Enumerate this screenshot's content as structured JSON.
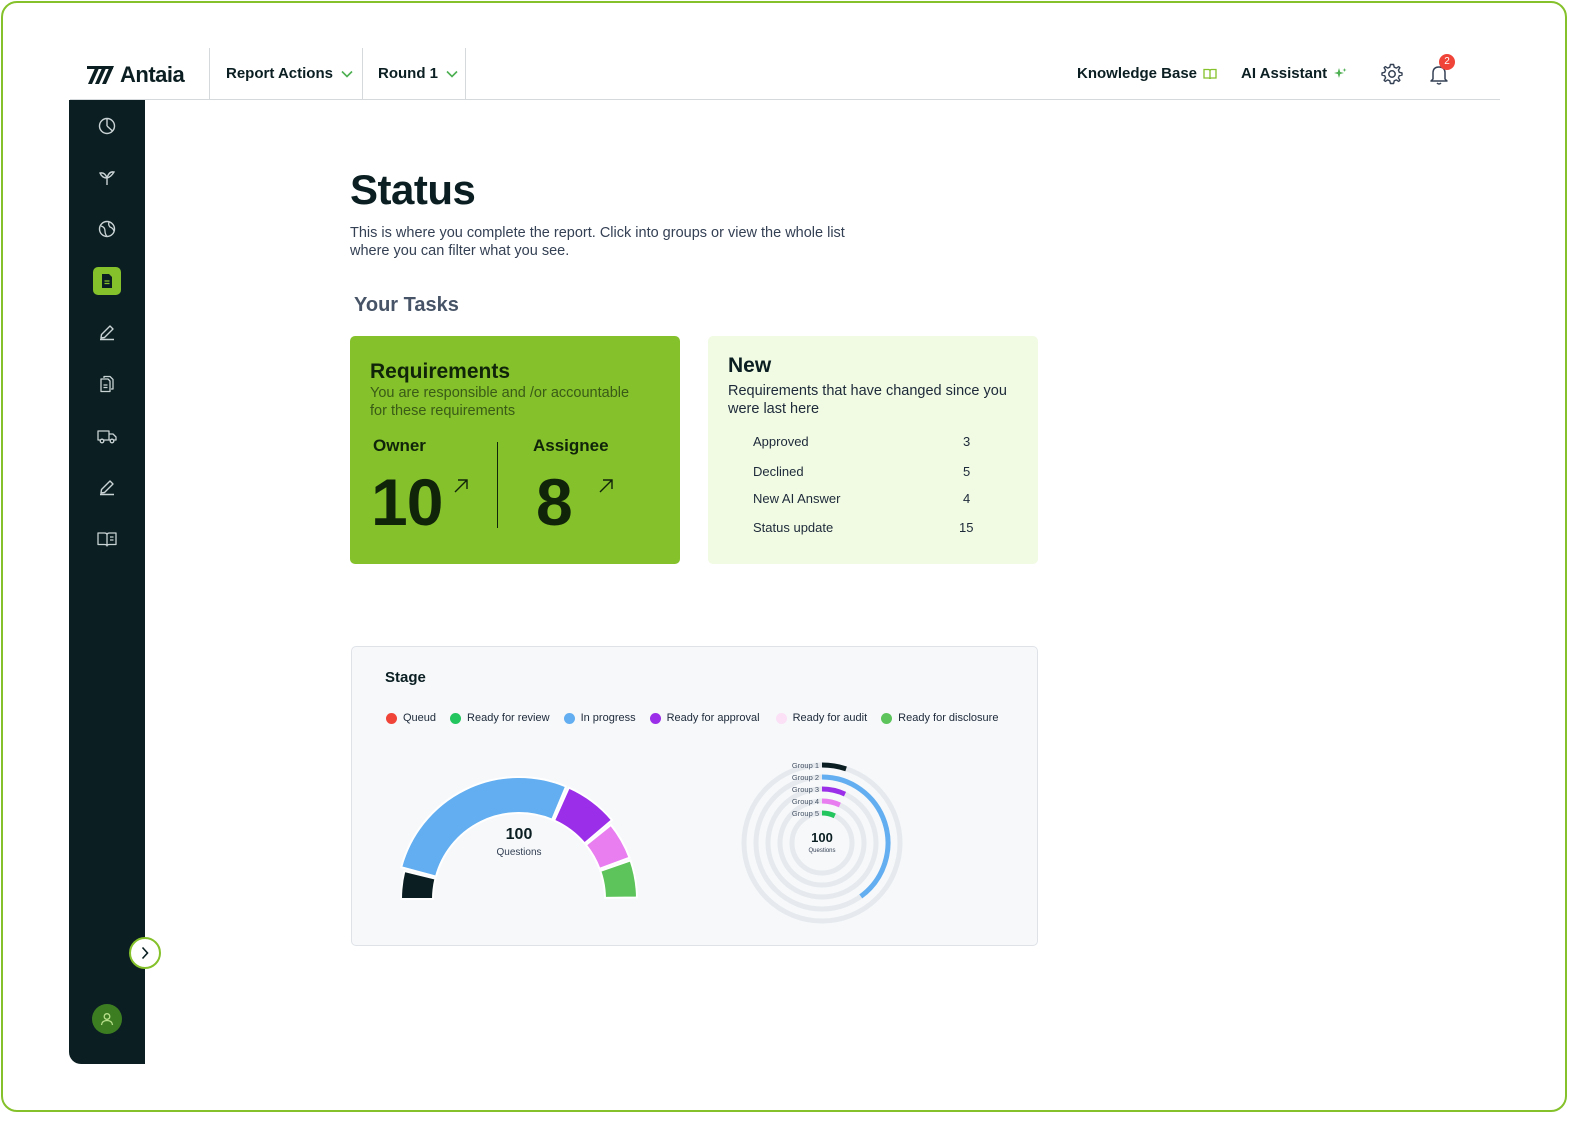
{
  "app": {
    "brand": "Antaia"
  },
  "header": {
    "menus": [
      {
        "label": "Report Actions"
      },
      {
        "label": "Round 1"
      }
    ],
    "knowledge_base": "Knowledge Base",
    "ai_assistant": "AI Assistant",
    "notification_count": "2"
  },
  "sidebar": {
    "items": [
      {
        "icon": "pie-chart-icon",
        "active": false
      },
      {
        "icon": "sprout-icon",
        "active": false
      },
      {
        "icon": "globe-icon",
        "active": false
      },
      {
        "icon": "document-icon",
        "active": true
      },
      {
        "icon": "pencil-icon",
        "active": false
      },
      {
        "icon": "files-icon",
        "active": false
      },
      {
        "icon": "truck-icon",
        "active": false
      },
      {
        "icon": "pencil-icon",
        "active": false
      },
      {
        "icon": "book-icon",
        "active": false
      }
    ]
  },
  "page": {
    "title": "Status",
    "subtitle": "This is where you complete the report. Click into groups or view the whole list where you can filter what you see.",
    "tasks_heading": "Your Tasks"
  },
  "requirements": {
    "title": "Requirements",
    "description": "You are responsible and /or accountable for these requirements",
    "owner_label": "Owner",
    "owner_count": "10",
    "assignee_label": "Assignee",
    "assignee_count": "8"
  },
  "new_changes": {
    "title": "New",
    "description": "Requirements that have changed since you were last here",
    "rows": [
      {
        "label": "Approved",
        "value": "3"
      },
      {
        "label": "Declined",
        "value": "5"
      },
      {
        "label": "New AI Answer",
        "value": "4"
      },
      {
        "label": "Status update",
        "value": "15"
      }
    ]
  },
  "stage": {
    "title": "Stage",
    "legend": [
      {
        "label": "Queud",
        "color": "#f04438"
      },
      {
        "label": "Ready for review",
        "color": "#22c55e"
      },
      {
        "label": "In progress",
        "color": "#62aef0"
      },
      {
        "label": "Ready for approval",
        "color": "#9b2ee8"
      },
      {
        "label": "Ready for audit",
        "color": "#fbe0f6"
      },
      {
        "label": "Ready for disclosure",
        "color": "#5cc45a"
      }
    ]
  },
  "chart_data": [
    {
      "type": "gauge",
      "center_value": "100",
      "center_label": "Questions",
      "total": 100,
      "segments": [
        {
          "color": "#0b1f22",
          "value": 8
        },
        {
          "color": "#62aef0",
          "value": 55
        },
        {
          "color": "#9b2ee8",
          "value": 15
        },
        {
          "color": "#e87ef0",
          "value": 11
        },
        {
          "color": "#5cc45a",
          "value": 11
        }
      ]
    },
    {
      "type": "radial-bar",
      "center_value": "100",
      "center_label": "Questions",
      "max": 100,
      "groups": [
        {
          "name": "Group 1",
          "color": "#0b1f22",
          "value": 5
        },
        {
          "name": "Group 2",
          "color": "#62aef0",
          "value": 40
        },
        {
          "name": "Group 3",
          "color": "#9b2ee8",
          "value": 7
        },
        {
          "name": "Group 4",
          "color": "#e87ef0",
          "value": 7
        },
        {
          "name": "Group 5",
          "color": "#22c55e",
          "value": 7
        }
      ]
    }
  ]
}
